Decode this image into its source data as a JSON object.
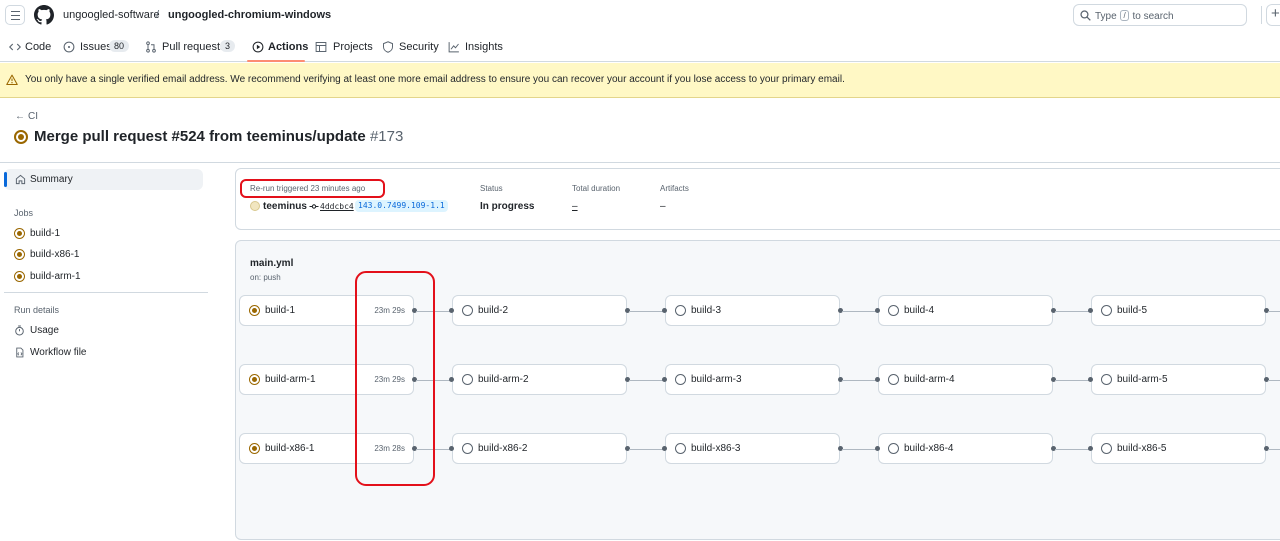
{
  "header": {
    "owner": "ungoogled-software",
    "separator": "/",
    "repo": "ungoogled-chromium-windows",
    "search": {
      "prefix": "Type",
      "key": "/",
      "suffix": "to search"
    },
    "plus": "+"
  },
  "nav": {
    "code": "Code",
    "issues": "Issues",
    "issues_count": "80",
    "pulls": "Pull requests",
    "pulls_count": "3",
    "actions": "Actions",
    "projects": "Projects",
    "security": "Security",
    "insights": "Insights"
  },
  "flash": {
    "message": "You only have a single verified email address. We recommend verifying at least one more email address to ensure you can recover your account if you lose access to your primary email."
  },
  "run": {
    "back_label": "CI",
    "title": "Merge pull request #524 from teeminus/update",
    "number": "#173"
  },
  "sidebar": {
    "summary": "Summary",
    "jobs_heading": "Jobs",
    "jobs": [
      "build-1",
      "build-x86-1",
      "build-arm-1"
    ],
    "run_details_heading": "Run details",
    "usage": "Usage",
    "workflow_file": "Workflow file"
  },
  "summary": {
    "triggered": "Re-run triggered 23 minutes ago",
    "actor": "teeminus",
    "sha": "4ddcbc4",
    "branch": "143.0.7499.109-1.1",
    "status_label": "Status",
    "status_value": "In progress",
    "duration_label": "Total duration",
    "duration_value": "–",
    "artifacts_label": "Artifacts",
    "artifacts_value": "–"
  },
  "workflow": {
    "file": "main.yml",
    "trigger": "on: push",
    "rows": [
      {
        "jobs": [
          "build-1",
          "build-2",
          "build-3",
          "build-4",
          "build-5"
        ],
        "first_duration": "23m 29s"
      },
      {
        "jobs": [
          "build-arm-1",
          "build-arm-2",
          "build-arm-3",
          "build-arm-4",
          "build-arm-5"
        ],
        "first_duration": "23m 29s"
      },
      {
        "jobs": [
          "build-x86-1",
          "build-x86-2",
          "build-x86-3",
          "build-x86-4",
          "build-x86-5"
        ],
        "first_duration": "23m 28s"
      }
    ]
  },
  "colors": {
    "in_progress": "#9a6700",
    "accent": "#0969da",
    "annotation": "#e3101a",
    "flash_bg": "#fff8c5"
  }
}
